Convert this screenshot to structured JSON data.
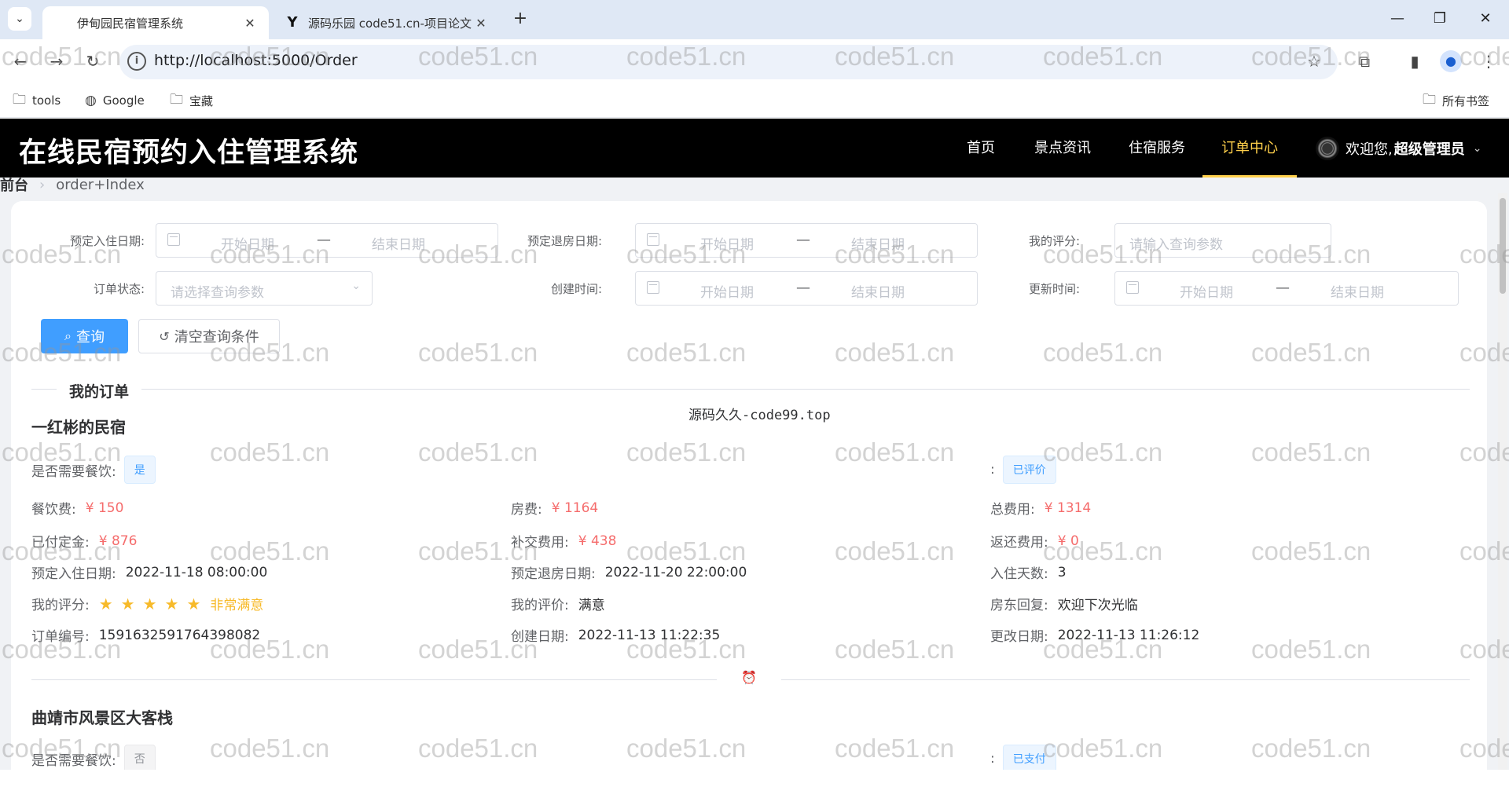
{
  "browser": {
    "tabs": [
      {
        "title": "伊甸园民宿管理系统",
        "active": true
      },
      {
        "title": "源码乐园 code51.cn-项目论文",
        "active": false
      }
    ],
    "url": "http://localhost:5000/Order",
    "bookmarks": [
      "tools",
      "Google",
      "宝藏"
    ],
    "all_bookmarks": "所有书签"
  },
  "site": {
    "title": "在线民宿预约入住管理系统",
    "nav": [
      "首页",
      "景点资讯",
      "住宿服务",
      "订单中心"
    ],
    "active_nav": "订单中心",
    "welcome": "欢迎您,",
    "username": "超级管理员"
  },
  "breadcrumb": {
    "home": "前台",
    "current": "order+Index"
  },
  "filters": {
    "checkin_label": "预定入住日期:",
    "checkout_label": "预定退房日期:",
    "rating_label": "我的评分:",
    "rating_placeholder": "请输入查询参数",
    "status_label": "订单状态:",
    "status_placeholder": "请选择查询参数",
    "created_label": "创建时间:",
    "updated_label": "更新时间:",
    "start_placeholder": "开始日期",
    "end_placeholder": "结束日期",
    "query_button": "查询",
    "clear_button": "清空查询条件"
  },
  "section_title": "我的订单",
  "center_watermark": "源码久久-code99.top",
  "labels": {
    "need_meal": "是否需要餐饮:",
    "status_colon": ":",
    "meal_fee": "餐饮费:",
    "room_fee": "房费:",
    "total_fee": "总费用:",
    "deposit": "已付定金:",
    "extra_fee": "补交费用:",
    "refund": "返还费用:",
    "checkin": "预定入住日期:",
    "checkout": "预定退房日期:",
    "days": "入住天数:",
    "my_score": "我的评分:",
    "my_review": "我的评价:",
    "host_reply": "房东回复:",
    "order_no": "订单编号:",
    "created": "创建日期:",
    "updated": "更改日期:"
  },
  "orders": [
    {
      "name": "一红彬的民宿",
      "need_meal": "是",
      "status": "已评价",
      "meal_fee": "¥ 150",
      "room_fee": "¥ 1164",
      "total_fee": "¥ 1314",
      "deposit": "¥ 876",
      "extra_fee": "¥ 438",
      "refund": "¥ 0",
      "checkin": "2022-11-18 08:00:00",
      "checkout": "2022-11-20 22:00:00",
      "days": "3",
      "stars": 5,
      "rating_text": "非常满意",
      "review": "满意",
      "host_reply": "欢迎下次光临",
      "order_no": "1591632591764398082",
      "created": "2022-11-13 11:22:35",
      "updated": "2022-11-13 11:26:12"
    },
    {
      "name": "曲靖市风景区大客栈",
      "need_meal": "否",
      "status": "已支付"
    }
  ],
  "watermark_text": "code51.cn",
  "colors": {
    "accent": "#409eff",
    "nav_active": "#ffd04b",
    "money": "#f56c6c",
    "star": "#f7ba2a"
  }
}
